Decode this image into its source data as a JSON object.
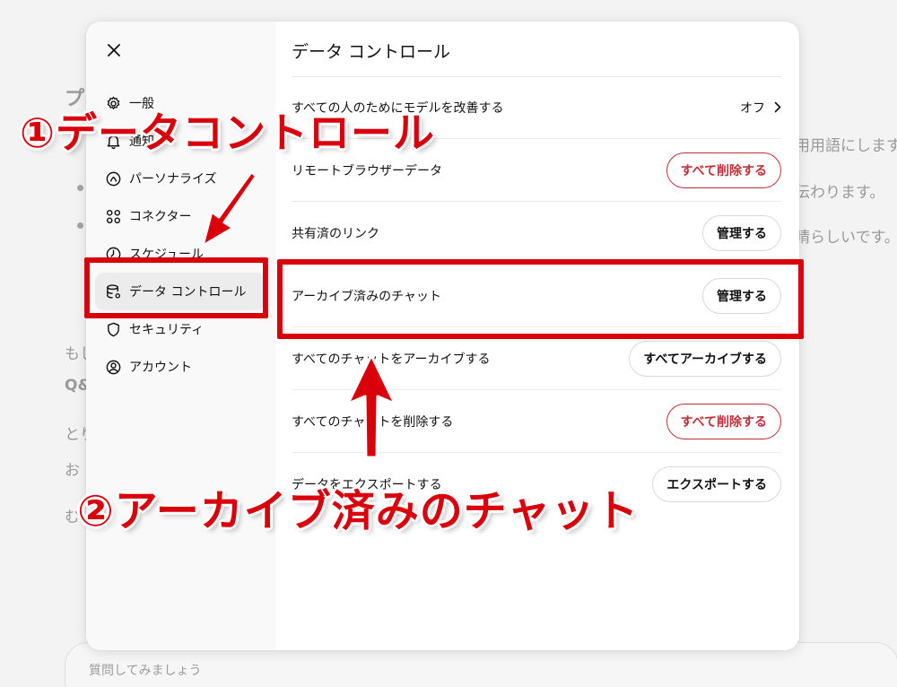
{
  "background": {
    "fragments": [
      "プ",
      "もし",
      "Q&",
      "とり",
      "お",
      "む",
      "用用語にします",
      "伝わります。",
      "晴らしいです。"
    ],
    "input_placeholder": "質問してみましょう"
  },
  "modal": {
    "close_glyph": "✕",
    "sidebar": {
      "items": [
        {
          "label": "一般",
          "icon": "gear-icon"
        },
        {
          "label": "通知",
          "icon": "bell-icon"
        },
        {
          "label": "パーソナライズ",
          "icon": "personalize-icon"
        },
        {
          "label": "コネクター",
          "icon": "connector-icon"
        },
        {
          "label": "スケジュール",
          "icon": "clock-icon"
        },
        {
          "label": "データ コントロール",
          "icon": "database-icon",
          "active": true
        },
        {
          "label": "セキュリティ",
          "icon": "shield-icon"
        },
        {
          "label": "アカウント",
          "icon": "account-icon"
        }
      ]
    },
    "main": {
      "title": "データ コントロール",
      "rows": [
        {
          "label": "すべての人のためにモデルを改善する",
          "value": "オフ",
          "control": "toggle"
        },
        {
          "label": "リモートブラウザーデータ",
          "button": "すべて削除する",
          "style": "danger"
        },
        {
          "label": "共有済のリンク",
          "button": "管理する",
          "style": "default"
        },
        {
          "label": "アーカイブ済みのチャット",
          "button": "管理する",
          "style": "default"
        },
        {
          "label": "すべてのチャットをアーカイブする",
          "button": "すべてアーカイブする",
          "style": "default"
        },
        {
          "label": "すべてのチャットを削除する",
          "button": "すべて削除する",
          "style": "danger"
        },
        {
          "label": "データをエクスポートする",
          "button": "エクスポートする",
          "style": "default"
        }
      ]
    }
  },
  "annotations": {
    "label1": "①データコントロール",
    "label2": "②アーカイブ済みのチャット",
    "color": "#d9000b"
  },
  "colors": {
    "danger": "#c0303a",
    "sidebar_bg": "#f9f9f9",
    "active_bg": "#ececec"
  }
}
